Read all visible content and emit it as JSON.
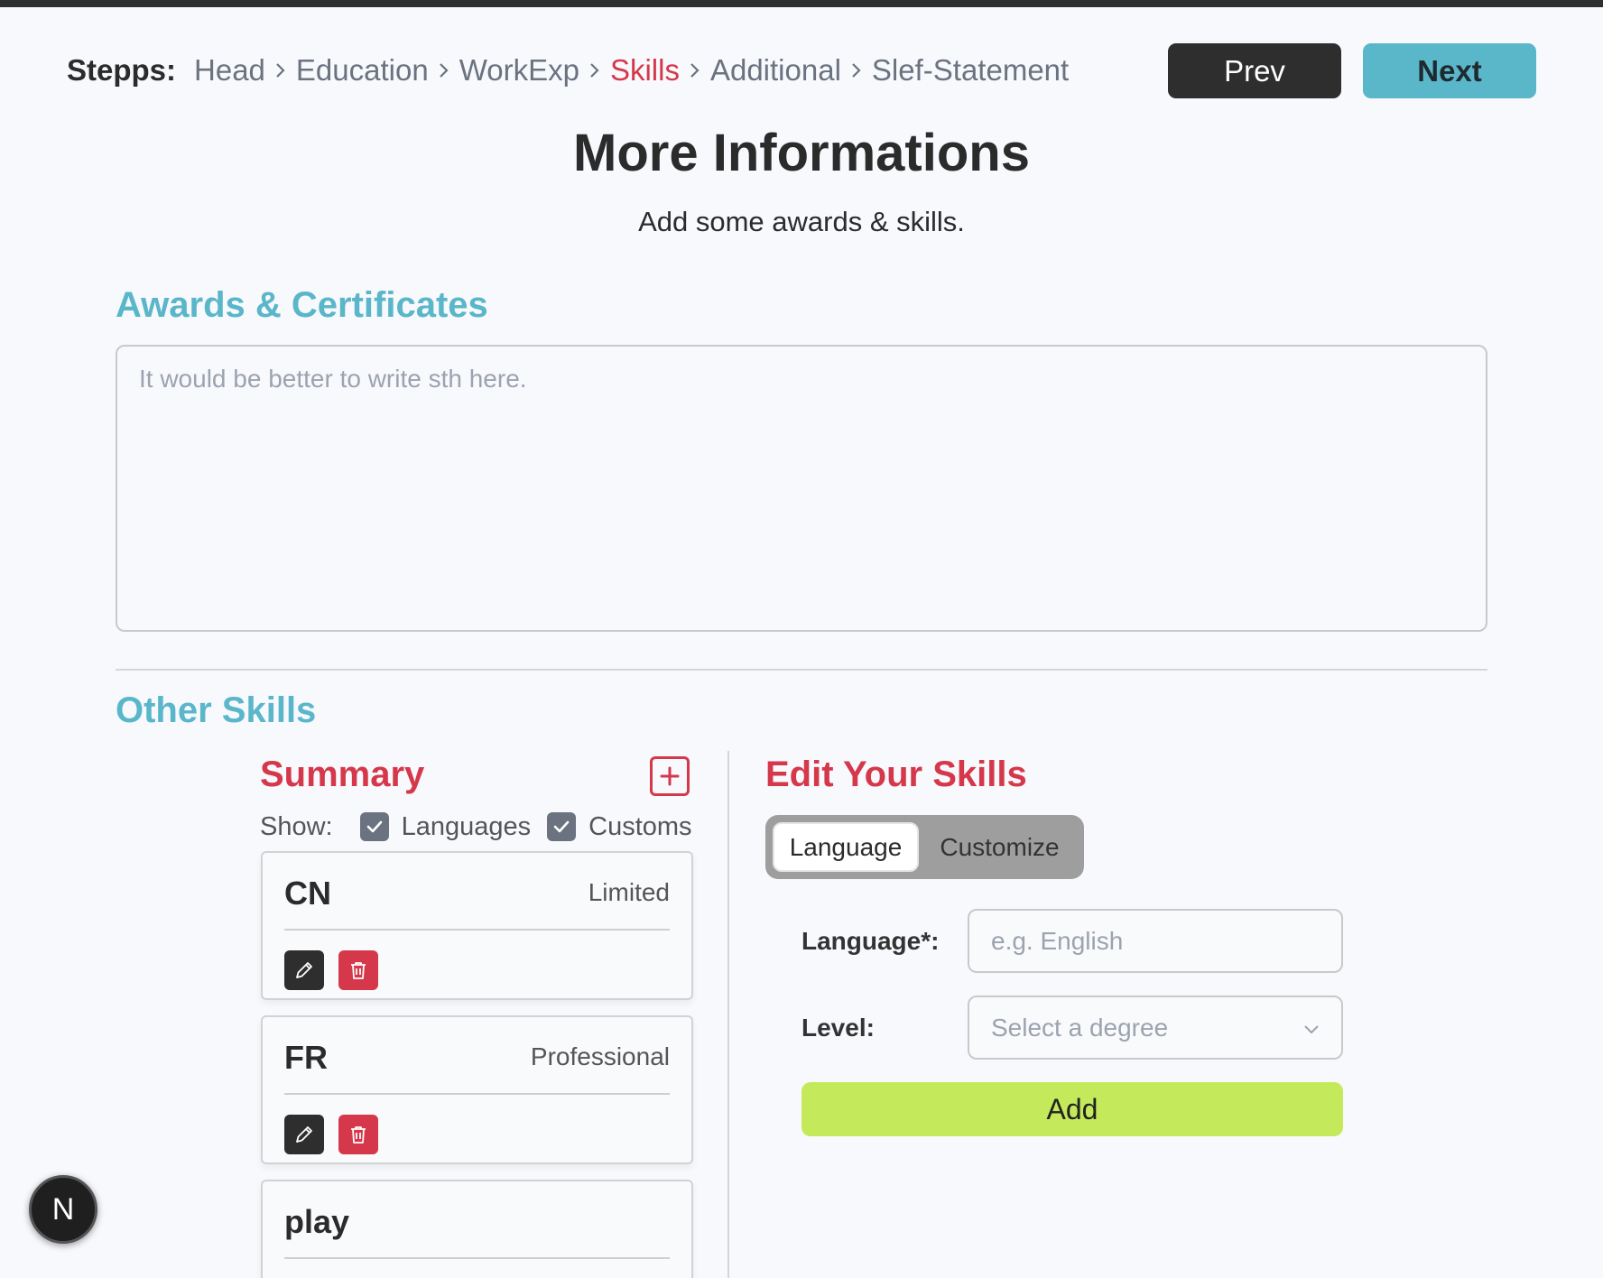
{
  "header": {
    "steps_label": "Stepps:",
    "steps": [
      "Head",
      "Education",
      "WorkExp",
      "Skills",
      "Additional",
      "Slef-Statement"
    ],
    "active_step": "Skills",
    "prev_label": "Prev",
    "next_label": "Next"
  },
  "page": {
    "title": "More Informations",
    "subtitle": "Add some awards & skills."
  },
  "awards": {
    "title": "Awards & Certificates",
    "placeholder": "It would be better to write sth here.",
    "value": ""
  },
  "skills": {
    "title": "Other Skills",
    "summary": {
      "title": "Summary",
      "show_label": "Show:",
      "filters": [
        {
          "label": "Languages",
          "checked": true
        },
        {
          "label": "Customs",
          "checked": true
        }
      ],
      "items": [
        {
          "name": "CN",
          "level": "Limited"
        },
        {
          "name": "FR",
          "level": "Professional"
        },
        {
          "name": "play",
          "level": ""
        }
      ]
    },
    "editor": {
      "title": "Edit Your Skills",
      "tabs": [
        "Language",
        "Customize"
      ],
      "active_tab": "Language",
      "language_label": "Language*:",
      "language_placeholder": "e.g. English",
      "level_label": "Level:",
      "level_placeholder": "Select a degree",
      "add_label": "Add"
    }
  },
  "badge": {
    "letter": "N"
  },
  "colors": {
    "accent_teal": "#5ab6c9",
    "accent_red": "#d5384a",
    "add_green": "#c4ea5c",
    "dark": "#2e2e2e"
  }
}
